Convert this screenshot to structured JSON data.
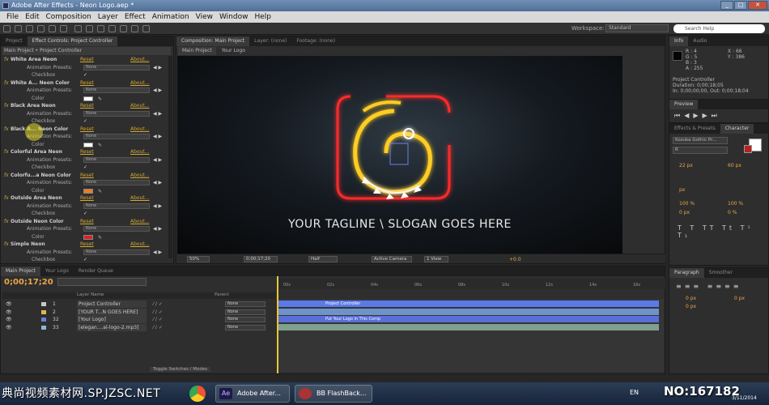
{
  "window": {
    "title": "Adobe After Effects - Neon Logo.aep *"
  },
  "menu": [
    "File",
    "Edit",
    "Composition",
    "Layer",
    "Effect",
    "Animation",
    "View",
    "Window",
    "Help"
  ],
  "toolbar": {
    "workspace_label": "Workspace:",
    "workspace": "Standard",
    "search_placeholder": "Search Help"
  },
  "left_panel": {
    "tabs": [
      "Project",
      "Effect Controls: Project Controller"
    ],
    "header": "Main Project • Project Controller",
    "reset": "Reset",
    "about": "About...",
    "anim_presets_label": "Animation Presets:",
    "preset_value": "None",
    "checkbox_label": "Checkbox",
    "color_label": "Color",
    "effects": [
      {
        "name": "White Area Neon",
        "kind": "preset"
      },
      {
        "name": "White A... Neon Color",
        "kind": "color",
        "color": "#ffffff"
      },
      {
        "name": "Black Area Neon",
        "kind": "preset"
      },
      {
        "name": "Black A... Neon Color",
        "kind": "color",
        "color": "#ffffff"
      },
      {
        "name": "Colorful Area Neon",
        "kind": "preset"
      },
      {
        "name": "Colorfu...a Neon Color",
        "kind": "color",
        "color": "#f07a22"
      },
      {
        "name": "Outside Area Neon",
        "kind": "preset"
      },
      {
        "name": "Outside Neon Color",
        "kind": "color",
        "color": "#e02020"
      },
      {
        "name": "Simple Neon",
        "kind": "preset"
      }
    ]
  },
  "composition": {
    "tabs": [
      "Composition: Main Project",
      "Layer: (none)",
      "Footage: (none)"
    ],
    "sub_tabs": [
      "Main Project",
      "Your Logo"
    ],
    "tagline": "YOUR TAGLINE \\ SLOGAN GOES HERE",
    "viewer_bar": {
      "zoom": "50%",
      "timecode": "0;00;17;20",
      "resolution": "Half",
      "camera": "Active Camera",
      "views": "1 View",
      "exposure": "+0.0"
    }
  },
  "info_panel": {
    "tabs": [
      "Info",
      "Audio"
    ],
    "r": "R : 4",
    "g": "G : 5",
    "b": "B : 3",
    "a": "A : 255",
    "x": "X : 66",
    "y": "Y : 386",
    "layer": "Project Controller",
    "duration": "Duration: 0;00;18;05",
    "inout": "In: 0;00;00;00, Out: 0;00;18;04"
  },
  "preview_panel": {
    "tab": "Preview"
  },
  "character_panel": {
    "tabs": [
      "Effects & Presets",
      "Character"
    ],
    "font": "Kozuka Gothic Pr...",
    "style": "R",
    "size": "22 px",
    "leading": "60 px",
    "tracking": "px",
    "scale_v": "100 %",
    "scale_h": "100 %",
    "baseline": "0 px",
    "tsume": "0 %"
  },
  "paragraph_panel": {
    "tabs": [
      "Paragraph",
      "Smoother"
    ],
    "indent_left": "0 px",
    "indent_right": "0 px",
    "space": "0 px"
  },
  "timeline": {
    "tabs": [
      "Main Project",
      "Your Logo",
      "Render Queue"
    ],
    "time": "0;00;17;20",
    "col_source": "Layer Name",
    "col_parent": "Parent",
    "parent_value": "None",
    "toggle_label": "Toggle Switches / Modes",
    "ruler": [
      "00s",
      "02s",
      "04s",
      "06s",
      "08s",
      "10s",
      "12s",
      "14s",
      "16s",
      "18s"
    ],
    "layers": [
      {
        "index": "1",
        "name": "Project Controller",
        "color": "#c9c9c9",
        "bar_color": "#5a7ae8",
        "bar_label": "Project Controller"
      },
      {
        "index": "2",
        "name": "[YOUR T...N GOES HERE]",
        "color": "#e0b84a",
        "bar_color": "#6f93c9",
        "bar_label": ""
      },
      {
        "index": "32",
        "name": "[Your Logo]",
        "color": "#6b7fd6",
        "bar_color": "#5a6fd8",
        "bar_label": "Put Your Logo in This Comp"
      },
      {
        "index": "33",
        "name": "[elegan....al-logo-2.mp3]",
        "color": "#8fb6d0",
        "bar_color": "#7f9f8f",
        "bar_label": ""
      }
    ]
  },
  "taskbar": {
    "items": [
      "Adobe After...",
      "BB FlashBack..."
    ],
    "tray": "EN",
    "date": "3/11/2014"
  },
  "watermarks": {
    "left": "典尚视频素材网.SP.JZSC.NET",
    "right": "NO:167182"
  },
  "colors": {
    "accent": "#e8a64a",
    "neon_red": "#ff2a2a",
    "neon_yellow": "#ffcc22"
  }
}
